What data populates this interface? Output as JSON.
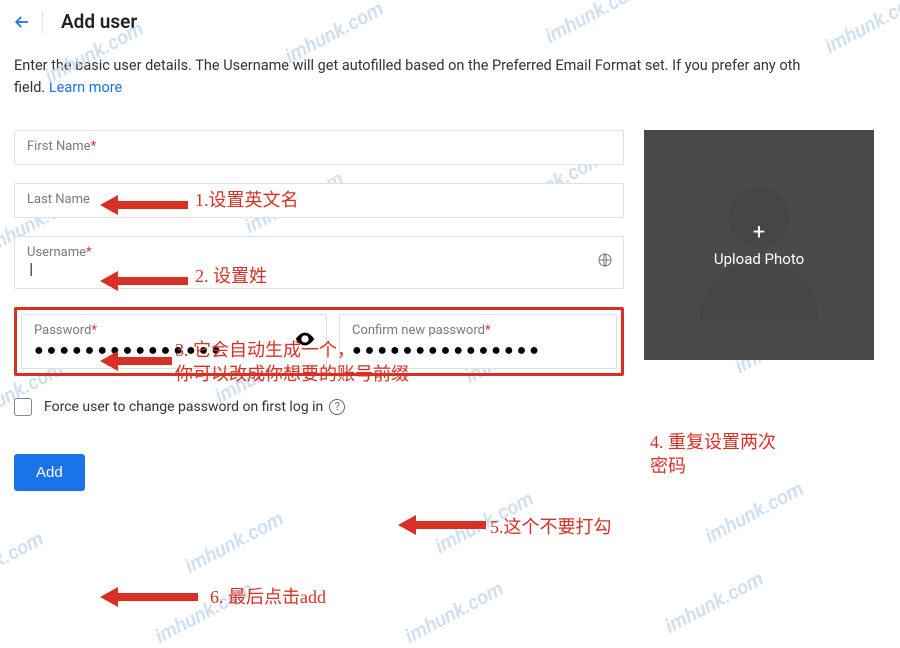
{
  "header": {
    "title": "Add user"
  },
  "intro": {
    "text": "Enter the basic user details. The Username will get autofilled based on the Preferred Email Format set. If you prefer any oth",
    "field_suffix": "field. ",
    "learn_more": "Learn more"
  },
  "fields": {
    "first_name_label": "First Name",
    "last_name_label": "Last Name",
    "username_label": "Username",
    "username_value": "|",
    "password_label": "Password",
    "confirm_label": "Confirm new password",
    "password_mask": "●●●●●●●●●●●●●●●",
    "confirm_mask": "●●●●●●●●●●●●●●●"
  },
  "checkbox": {
    "label": "Force user to change password on first log in"
  },
  "button": {
    "add": "Add"
  },
  "upload": {
    "label": "Upload Photo"
  },
  "annotations": {
    "a1": "1.设置英文名",
    "a2": "2. 设置姓",
    "a3": "3. 它会自动生成一个，\n你可以改成你想要的账号前缀",
    "a4": "4. 重复设置两次\n密码",
    "a5": "5.这个不要打勾",
    "a6": "6. 最后点击add"
  },
  "watermark": "imhunk.com"
}
